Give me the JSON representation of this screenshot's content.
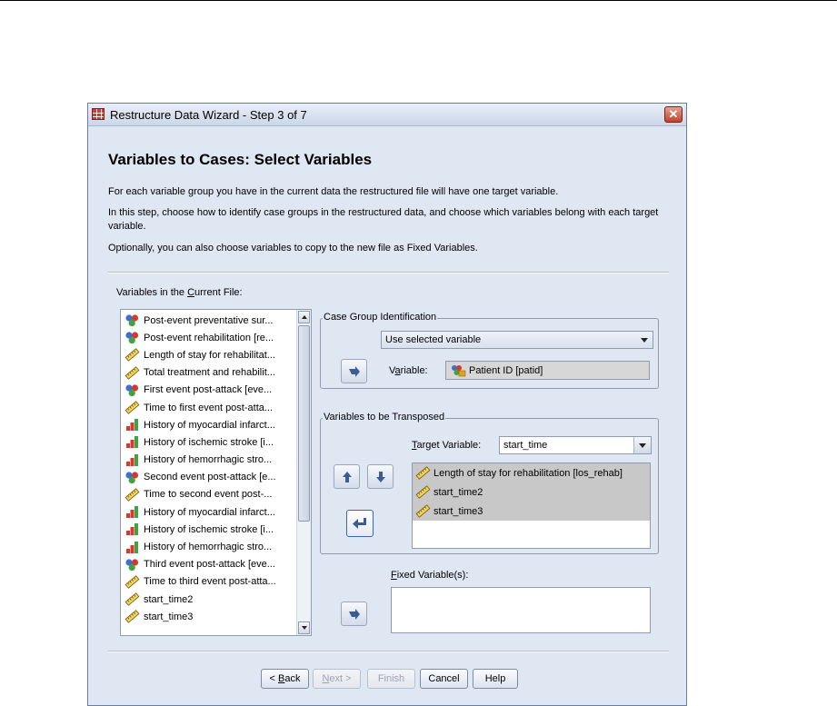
{
  "window": {
    "title": "Restructure Data Wizard - Step 3 of 7",
    "close_glyph": "✕"
  },
  "header": {
    "heading": "Variables to Cases: Select Variables",
    "desc1": "For each variable group you have in the current data the restructured file will have one target variable.",
    "desc2": "In this step, choose how to identify case groups in the restructured data, and choose which variables belong with each target variable.",
    "desc3": "Optionally, you can also choose variables to copy to the new file as Fixed Variables."
  },
  "varlist": {
    "label_pre": "Variables in the ",
    "label_key": "C",
    "label_post": "urrent File:",
    "items": [
      {
        "label": "Post-event preventative sur...",
        "icon": "nominal-icon"
      },
      {
        "label": "Post-event rehabilitation [re...",
        "icon": "nominal-icon"
      },
      {
        "label": "Length of stay for rehabilitat...",
        "icon": "scale-icon"
      },
      {
        "label": "Total treatment and rehabilit...",
        "icon": "scale-icon"
      },
      {
        "label": "First event post-attack [eve...",
        "icon": "nominal-icon"
      },
      {
        "label": "Time to first event post-atta...",
        "icon": "scale-icon"
      },
      {
        "label": "History of myocardial infarct...",
        "icon": "ordinal-icon"
      },
      {
        "label": "History of ischemic stroke [i...",
        "icon": "ordinal-icon"
      },
      {
        "label": "History of hemorrhagic stro...",
        "icon": "ordinal-icon"
      },
      {
        "label": "Second event post-attack [e...",
        "icon": "nominal-icon"
      },
      {
        "label": "Time to second event post-...",
        "icon": "scale-icon"
      },
      {
        "label": "History of myocardial infarct...",
        "icon": "ordinal-icon"
      },
      {
        "label": "History of ischemic stroke [i...",
        "icon": "ordinal-icon"
      },
      {
        "label": "History of hemorrhagic stro...",
        "icon": "ordinal-icon"
      },
      {
        "label": "Third event post-attack [eve...",
        "icon": "nominal-icon"
      },
      {
        "label": "Time to third event post-atta...",
        "icon": "scale-icon"
      },
      {
        "label": "start_time2",
        "icon": "scale-icon"
      },
      {
        "label": "start_time3",
        "icon": "scale-icon"
      }
    ]
  },
  "case_group": {
    "title": "Case Group Identification",
    "dropdown_value": "Use selected variable",
    "variable_label_pre": "V",
    "variable_label_key": "a",
    "variable_label_post": "riable:",
    "variable_value": "Patient ID [patid]"
  },
  "transposed": {
    "title": "Variables to be Transposed",
    "target_label_key": "T",
    "target_label_post": "arget Variable:",
    "target_value": "start_time",
    "items": [
      {
        "label": "Length of stay for rehabilitation [los_rehab]",
        "icon": "scale-icon"
      },
      {
        "label": "start_time2",
        "icon": "scale-icon"
      },
      {
        "label": "start_time3",
        "icon": "scale-icon"
      }
    ]
  },
  "fixed": {
    "label_key": "F",
    "label_post": "ixed Variable(s):"
  },
  "buttons": {
    "back_pre": "< ",
    "back_key": "B",
    "back_post": "ack",
    "next_key": "N",
    "next_post": "ext >",
    "finish": "Finish",
    "cancel": "Cancel",
    "help": "Help"
  }
}
